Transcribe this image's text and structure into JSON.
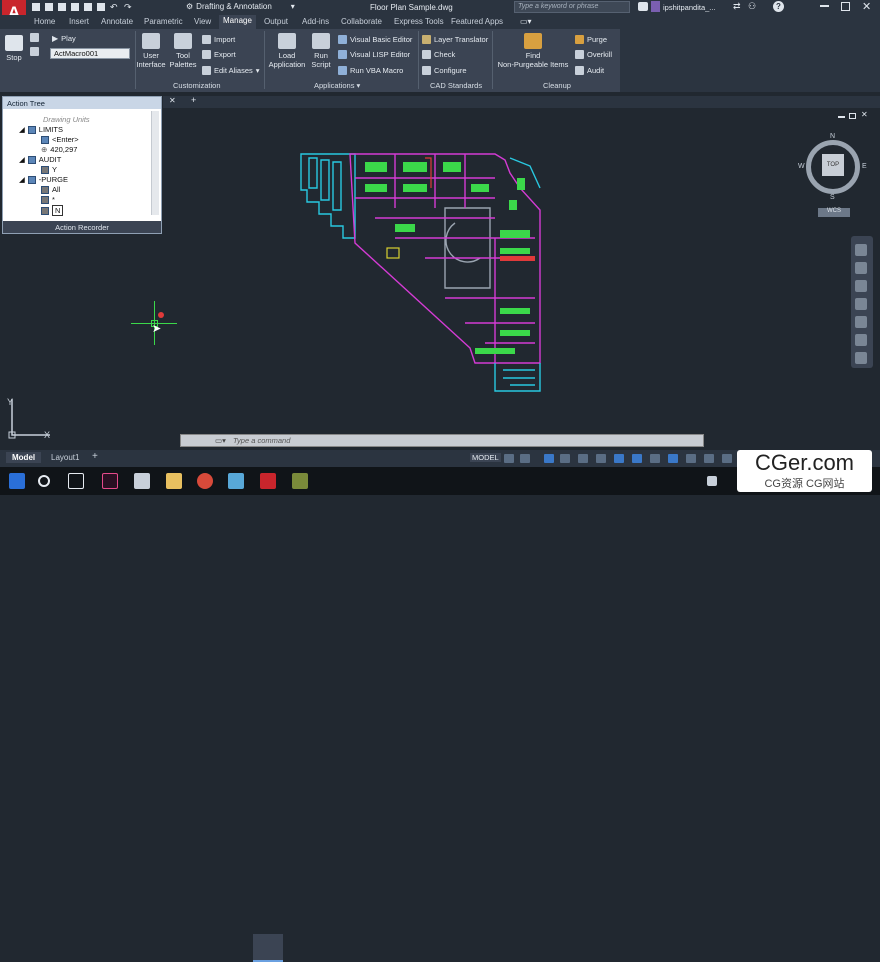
{
  "titlebar": {
    "workspace": "Drafting & Annotation",
    "filename": "Floor Plan Sample.dwg",
    "search_placeholder": "Type a keyword or phrase",
    "user": "ipshitpandita_...",
    "app_letter": "A"
  },
  "ribbon_tabs": [
    "Home",
    "Insert",
    "Annotate",
    "Parametric",
    "View",
    "Manage",
    "Output",
    "Add-ins",
    "Collaborate",
    "Express Tools",
    "Featured Apps"
  ],
  "active_tab": "Manage",
  "ribbon": {
    "stop": "Stop",
    "play": "Play",
    "macro_value": "ActMacro001",
    "user_interface": "User\nInterface",
    "tool_palettes": "Tool\nPalettes",
    "import": "Import",
    "export": "Export",
    "edit_aliases": "Edit Aliases",
    "customization": "Customization",
    "load_application": "Load\nApplication",
    "run_script": "Run\nScript",
    "vb_editor": "Visual Basic Editor",
    "lisp_editor": "Visual LISP Editor",
    "run_vba": "Run VBA Macro",
    "applications": "Applications",
    "layer_translator": "Layer Translator",
    "check": "Check",
    "configure": "Configure",
    "cad_standards": "CAD Standards",
    "find_purge": "Find\nNon-Purgeable Items",
    "purge": "Purge",
    "overkill": "Overkill",
    "audit": "Audit",
    "cleanup": "Cleanup"
  },
  "action_tree": {
    "title": "Action Tree",
    "rows": [
      "Drawing Units",
      "LIMITS",
      "<Enter>",
      "420,297",
      "AUDIT",
      "Y",
      "-PURGE",
      "All",
      "*",
      "N"
    ],
    "footer": "Action Recorder"
  },
  "viewcube": {
    "face": "TOP",
    "n": "N",
    "s": "S",
    "e": "E",
    "w": "W",
    "wcs": "WCS"
  },
  "ucs": {
    "x": "X",
    "y": "Y"
  },
  "command": {
    "placeholder": "Type a command"
  },
  "layout_tabs": [
    "Model",
    "Layout1"
  ],
  "status": {
    "model": "MODEL"
  },
  "watermark": {
    "big": "CGer.com",
    "small": "CG资源 CG网站"
  },
  "colors": {
    "cyan": "#29c8e0",
    "magenta": "#d43bd4",
    "green": "#3bd84a",
    "yellow": "#d8d030",
    "red": "#e03a3a",
    "grey": "#9aa4b0"
  }
}
